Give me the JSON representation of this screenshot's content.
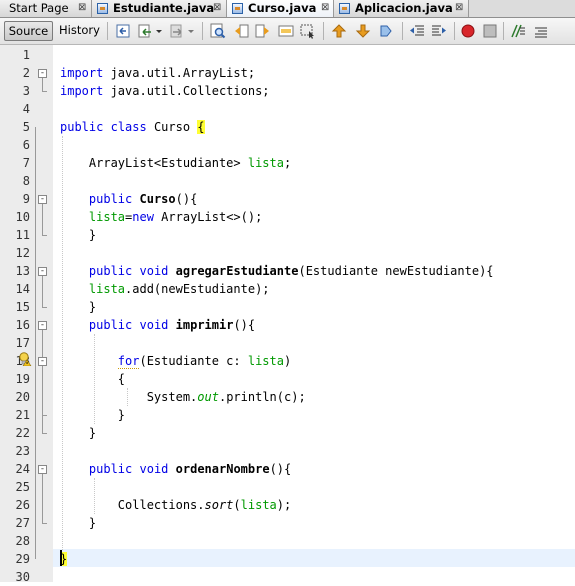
{
  "tabs": [
    {
      "label": "Start Page",
      "bold": false,
      "active": false,
      "icon": "none"
    },
    {
      "label": "Estudiante.java",
      "bold": true,
      "active": false,
      "icon": "java-file-icon"
    },
    {
      "label": "Curso.java",
      "bold": true,
      "active": true,
      "icon": "java-file-icon"
    },
    {
      "label": "Aplicacion.java",
      "bold": true,
      "active": false,
      "icon": "java-file-icon"
    }
  ],
  "tab_close_glyph": "⊠",
  "toolbar": {
    "source_label": "Source",
    "history_label": "History",
    "icons": [
      "last-edit-icon",
      "back-icon",
      "dropdown-arrow-icon",
      "forward-icon",
      "dropdown-arrow-icon",
      "find-icon",
      "find-previous-icon",
      "find-next-icon",
      "find-selection-icon",
      "toggle-highlight-icon",
      "previous-bookmark-icon",
      "next-bookmark-icon",
      "toggle-bookmark-icon",
      "shift-left-icon",
      "shift-right-icon",
      "start-macro-icon",
      "stop-macro-icon",
      "comment-icon",
      "uncomment-icon"
    ]
  },
  "editor": {
    "line_numbers": [
      "1",
      "2",
      "3",
      "4",
      "5",
      "6",
      "7",
      "8",
      "9",
      "10",
      "11",
      "12",
      "13",
      "14",
      "15",
      "16",
      "17",
      "18",
      "19",
      "20",
      "21",
      "22",
      "23",
      "24",
      "25",
      "26",
      "27",
      "28",
      "29",
      "30"
    ],
    "current_line": "29",
    "hint_icon": "lightbulb-warning-icon",
    "lines": [
      [],
      [
        {
          "t": "import",
          "c": "kw"
        },
        {
          "t": " java.util.ArrayList;"
        }
      ],
      [
        {
          "t": "import",
          "c": "kw"
        },
        {
          "t": " java.util.Collections;"
        }
      ],
      [],
      [
        {
          "t": "public",
          "c": "kw"
        },
        {
          "t": " "
        },
        {
          "t": "class",
          "c": "kw"
        },
        {
          "t": " Curso "
        },
        {
          "t": "{",
          "c": "brace-hl"
        }
      ],
      [],
      [
        {
          "t": "    ArrayList<Estudiante> "
        },
        {
          "t": "lista",
          "c": "fld"
        },
        {
          "t": ";"
        }
      ],
      [],
      [
        {
          "t": "    "
        },
        {
          "t": "public",
          "c": "kw"
        },
        {
          "t": " "
        },
        {
          "t": "Curso",
          "c": "mdecl"
        },
        {
          "t": "(){"
        }
      ],
      [
        {
          "t": "    "
        },
        {
          "t": "lista",
          "c": "fld"
        },
        {
          "t": "="
        },
        {
          "t": "new",
          "c": "kw"
        },
        {
          "t": " ArrayList<>();"
        }
      ],
      [
        {
          "t": "    }"
        }
      ],
      [],
      [
        {
          "t": "    "
        },
        {
          "t": "public",
          "c": "kw"
        },
        {
          "t": " "
        },
        {
          "t": "void",
          "c": "kw"
        },
        {
          "t": " "
        },
        {
          "t": "agregarEstudiante",
          "c": "mdecl"
        },
        {
          "t": "(Estudiante newEstudiante){"
        }
      ],
      [
        {
          "t": "    "
        },
        {
          "t": "lista",
          "c": "fld"
        },
        {
          "t": ".add(newEstudiante);"
        }
      ],
      [
        {
          "t": "    }"
        }
      ],
      [
        {
          "t": "    "
        },
        {
          "t": "public",
          "c": "kw"
        },
        {
          "t": " "
        },
        {
          "t": "void",
          "c": "kw"
        },
        {
          "t": " "
        },
        {
          "t": "imprimir",
          "c": "mdecl"
        },
        {
          "t": "(){"
        }
      ],
      [],
      [
        {
          "t": "        "
        },
        {
          "t": "for",
          "c": "kw wavy"
        },
        {
          "t": "(Estudiante c: "
        },
        {
          "t": "lista",
          "c": "fld"
        },
        {
          "t": ")"
        }
      ],
      [
        {
          "t": "        {"
        }
      ],
      [
        {
          "t": "            System."
        },
        {
          "t": "out",
          "c": "ofld"
        },
        {
          "t": ".println(c);"
        }
      ],
      [
        {
          "t": "        }"
        }
      ],
      [
        {
          "t": "    }"
        }
      ],
      [],
      [
        {
          "t": "    "
        },
        {
          "t": "public",
          "c": "kw"
        },
        {
          "t": " "
        },
        {
          "t": "void",
          "c": "kw"
        },
        {
          "t": " "
        },
        {
          "t": "ordenarNombre",
          "c": "mdecl"
        },
        {
          "t": "(){"
        }
      ],
      [],
      [
        {
          "t": "        Collections."
        },
        {
          "t": "sort",
          "c": "stat"
        },
        {
          "t": "("
        },
        {
          "t": "lista",
          "c": "fld"
        },
        {
          "t": ");"
        }
      ],
      [
        {
          "t": "    }"
        }
      ],
      [],
      [
        {
          "t": "}",
          "c": "brace-hl"
        }
      ],
      []
    ]
  }
}
